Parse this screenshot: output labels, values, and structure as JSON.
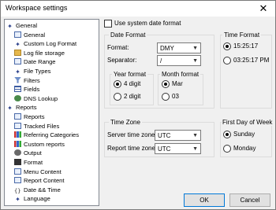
{
  "window": {
    "title": "Workspace settings",
    "close_glyph": "✕"
  },
  "tree": {
    "nodes": [
      {
        "label": "General",
        "icon": "star-icon"
      },
      {
        "label": "General",
        "icon": "document-icon"
      },
      {
        "label": "Custom Log Format",
        "icon": "star-icon"
      },
      {
        "label": "Log file storage",
        "icon": "folder-icon"
      },
      {
        "label": "Date Range",
        "icon": "calendar-icon"
      },
      {
        "label": "File Types",
        "icon": "star-icon"
      },
      {
        "label": "Filters",
        "icon": "filter-icon"
      },
      {
        "label": "Fields",
        "icon": "list-icon"
      },
      {
        "label": "DNS Lookup",
        "icon": "lookup-icon"
      },
      {
        "label": "Reports",
        "icon": "star-icon"
      },
      {
        "label": "Reports",
        "icon": "document-icon"
      },
      {
        "label": "Tracked Files",
        "icon": "document-icon"
      },
      {
        "label": "Referring Categories",
        "icon": "chart-icon"
      },
      {
        "label": "Custom reports",
        "icon": "chart-icon"
      },
      {
        "label": "Output",
        "icon": "gear-icon"
      },
      {
        "label": "Format",
        "icon": "format-icon"
      },
      {
        "label": "Menu Content",
        "icon": "document-icon"
      },
      {
        "label": "Report Content",
        "icon": "document-icon"
      },
      {
        "label": "Date && Time",
        "icon": "brace-icon"
      },
      {
        "label": "Language",
        "icon": "star-icon"
      }
    ]
  },
  "system_date": {
    "label": "Use system date format",
    "checked": false
  },
  "date_format": {
    "legend": "Date Format",
    "format_label": "Format:",
    "format_value": "DMY",
    "separator_label": "Separator:",
    "separator_value": "/",
    "year_format": {
      "legend": "Year format",
      "opt1": "4 digit",
      "opt2": "2 digit",
      "selected": "4 digit"
    },
    "month_format": {
      "legend": "Month format",
      "opt1": "Mar",
      "opt2": "03",
      "selected": "Mar"
    }
  },
  "time_format": {
    "legend": "Time Format",
    "opt1": "15:25:17",
    "opt2": "03:25:17 PM",
    "selected": "15:25:17"
  },
  "time_zone": {
    "legend": "Time Zone",
    "server_label": "Server time zone:",
    "server_value": "UTC",
    "report_label": "Report time zone:",
    "report_value": "UTC"
  },
  "first_day": {
    "legend": "First Day of Week",
    "opt1": "Sunday",
    "opt2": "Monday",
    "selected": "Sunday"
  },
  "buttons": {
    "ok": "OK",
    "cancel": "Cancel"
  },
  "colors": {
    "accent": "#0078d7",
    "tree_icon": "#2a3f8a"
  }
}
